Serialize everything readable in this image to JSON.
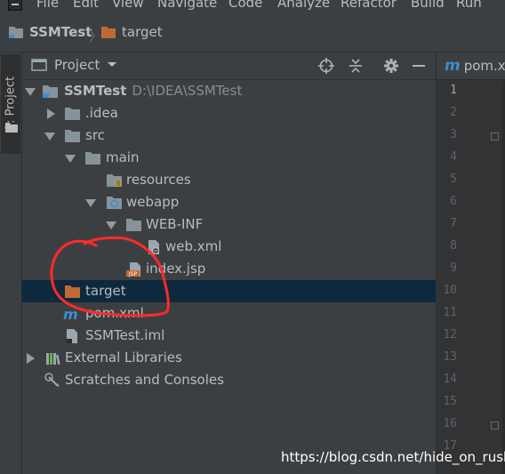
{
  "menu": {
    "items": [
      {
        "label": "File"
      },
      {
        "label": "Edit"
      },
      {
        "label": "View"
      },
      {
        "label": "Navigate"
      },
      {
        "label": "Code"
      },
      {
        "label": "Analyze"
      },
      {
        "label": "Refactor"
      },
      {
        "label": "Build"
      },
      {
        "label": "Run"
      }
    ]
  },
  "breadcrumb": {
    "project": "SSMTest",
    "folder": "target"
  },
  "toolwindow": {
    "tab_label": "1: Project"
  },
  "panel": {
    "title": "Project"
  },
  "tree": {
    "items": [
      {
        "label": "SSMTest",
        "path": "D:\\IDEA\\SSMTest"
      },
      {
        "label": ".idea"
      },
      {
        "label": "src"
      },
      {
        "label": "main"
      },
      {
        "label": "resources"
      },
      {
        "label": "webapp"
      },
      {
        "label": "WEB-INF"
      },
      {
        "label": "web.xml"
      },
      {
        "label": "index.jsp"
      },
      {
        "label": "target",
        "selected": true
      },
      {
        "label": "pom.xml"
      },
      {
        "label": "SSMTest.iml"
      },
      {
        "label": "External Libraries"
      },
      {
        "label": "Scratches and Consoles"
      }
    ]
  },
  "editor": {
    "tab_label": "pom.x",
    "line_numbers": [
      "1",
      "2",
      "3",
      "4",
      "5",
      "6",
      "7",
      "8",
      "9",
      "10",
      "11",
      "12",
      "13",
      "14",
      "15",
      "16",
      "17"
    ]
  },
  "watermark": "https://blog.csdn.net/hide_on_rush",
  "colors": {
    "background": "#3c3f41",
    "selection": "#0d293e",
    "folder": "#87939a",
    "excluded_folder": "#c06a33",
    "annotation": "#ff2a2a"
  }
}
